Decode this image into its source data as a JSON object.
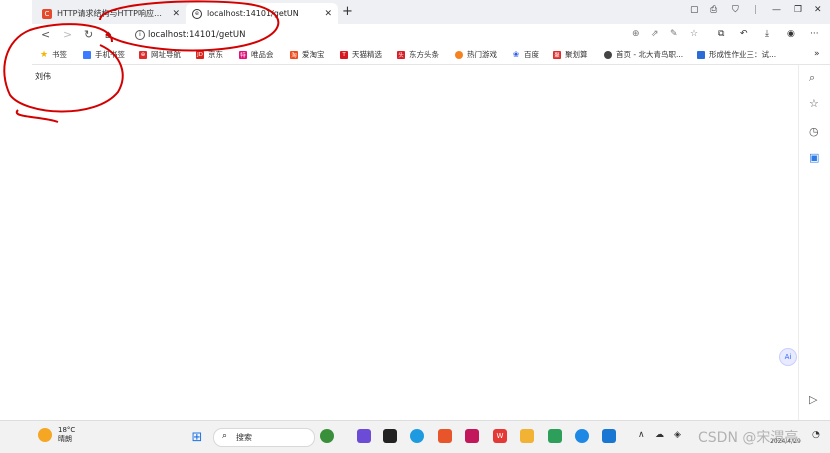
{
  "tabs": [
    {
      "title": "HTTP请求结构与HTTP响应结构...",
      "favicon": "csdn-icon"
    },
    {
      "title": "localhost:14101/getUN",
      "favicon": "edge-page-icon"
    }
  ],
  "address": {
    "url": "localhost:14101/getUN"
  },
  "bookmarks": [
    {
      "label": "书签",
      "color": "#f5b400",
      "icon": "star-icon"
    },
    {
      "label": "手机书签",
      "color": "#3b7bff",
      "icon": "phone-icon"
    },
    {
      "label": "网址导航",
      "color": "#e02b2b",
      "icon": "nav-icon"
    },
    {
      "label": "京东",
      "color": "#d9241c",
      "icon": "jd-icon",
      "short": "JD"
    },
    {
      "label": "唯品会",
      "color": "#e4117a",
      "icon": "vip-icon",
      "short": "特"
    },
    {
      "label": "爱淘宝",
      "color": "#ee4d1b",
      "icon": "taobao-icon",
      "short": "淘"
    },
    {
      "label": "天猫精选",
      "color": "#d8171e",
      "icon": "tmall-icon",
      "short": "T"
    },
    {
      "label": "东方头条",
      "color": "#d61f26",
      "icon": "toutiao-icon",
      "short": "头"
    },
    {
      "label": "热门游戏",
      "color": "#f58220",
      "icon": "game-icon"
    },
    {
      "label": "百度",
      "color": "#2f5bea",
      "icon": "baidu-icon"
    },
    {
      "label": "聚划算",
      "color": "#e02b2b",
      "icon": "juhuasuan-icon",
      "short": "聚"
    },
    {
      "label": "首页 - 北大青鸟职...",
      "color": "#444444",
      "icon": "edge-icon"
    },
    {
      "label": "形成性作业三：试...",
      "color": "#2b6cd6",
      "icon": "doc-icon"
    }
  ],
  "page": {
    "body_text": "刘伟"
  },
  "taskbar": {
    "temp": "18°C",
    "weather": "晴朗",
    "search_label": "搜索",
    "watermark": "CSDN @宋渭亮",
    "date": "2024/4/29"
  }
}
